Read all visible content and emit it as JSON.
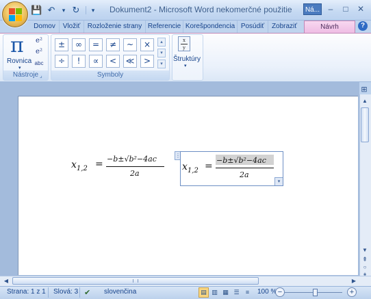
{
  "window": {
    "title": "Dokument2 - Microsoft Word nekomerčné použitie",
    "contextual_label": "Ná...",
    "buttons": {
      "minimize": "–",
      "maximize": "□",
      "close": "✕"
    }
  },
  "quick_access": {
    "save_icon": "💾",
    "undo_icon": "↶",
    "redo_icon": "↻",
    "customize_icon": "▾"
  },
  "tabs": [
    {
      "label": "Domov"
    },
    {
      "label": "Vložiť"
    },
    {
      "label": "Rozloženie strany"
    },
    {
      "label": "Referencie"
    },
    {
      "label": "Korešpondencia"
    },
    {
      "label": "Posúdiť"
    },
    {
      "label": "Zobraziť"
    },
    {
      "label": "Návrh"
    }
  ],
  "help": "?",
  "ribbon": {
    "nastroje": {
      "label": "Nástroje",
      "equation_icon": "π",
      "equation_label": "Rovnica",
      "dropdown": "▾",
      "small_icons": [
        "e²",
        "e²",
        "abc"
      ]
    },
    "symboly": {
      "label": "Symboly",
      "row1": [
        "±",
        "∞",
        "=",
        "≠",
        "~",
        "×"
      ],
      "row2": [
        "÷",
        "!",
        "∝",
        "<",
        "≪",
        ">"
      ],
      "row2_last": "≫",
      "scroll": [
        "▴",
        "▾",
        "▾"
      ]
    },
    "struktury": {
      "label": "Štruktúry",
      "icon_top": "x",
      "icon_bottom": "y",
      "dropdown": "▾"
    }
  },
  "document": {
    "equation_left": {
      "lhs": "x",
      "lhs_sub": "1,2",
      "equals": "=",
      "numerator": "−b±√b²−4ac",
      "denominator": "2a"
    },
    "equation_right": {
      "lhs": "x",
      "lhs_sub": "1,2",
      "equals": "=",
      "numerator": "−b±√b²−4ac",
      "denominator": "2a"
    }
  },
  "status": {
    "page": "Strana: 1 z 1",
    "words": "Slová: 3",
    "language": "slovenčina",
    "zoom": "100 %",
    "zoom_level": 1.0
  }
}
